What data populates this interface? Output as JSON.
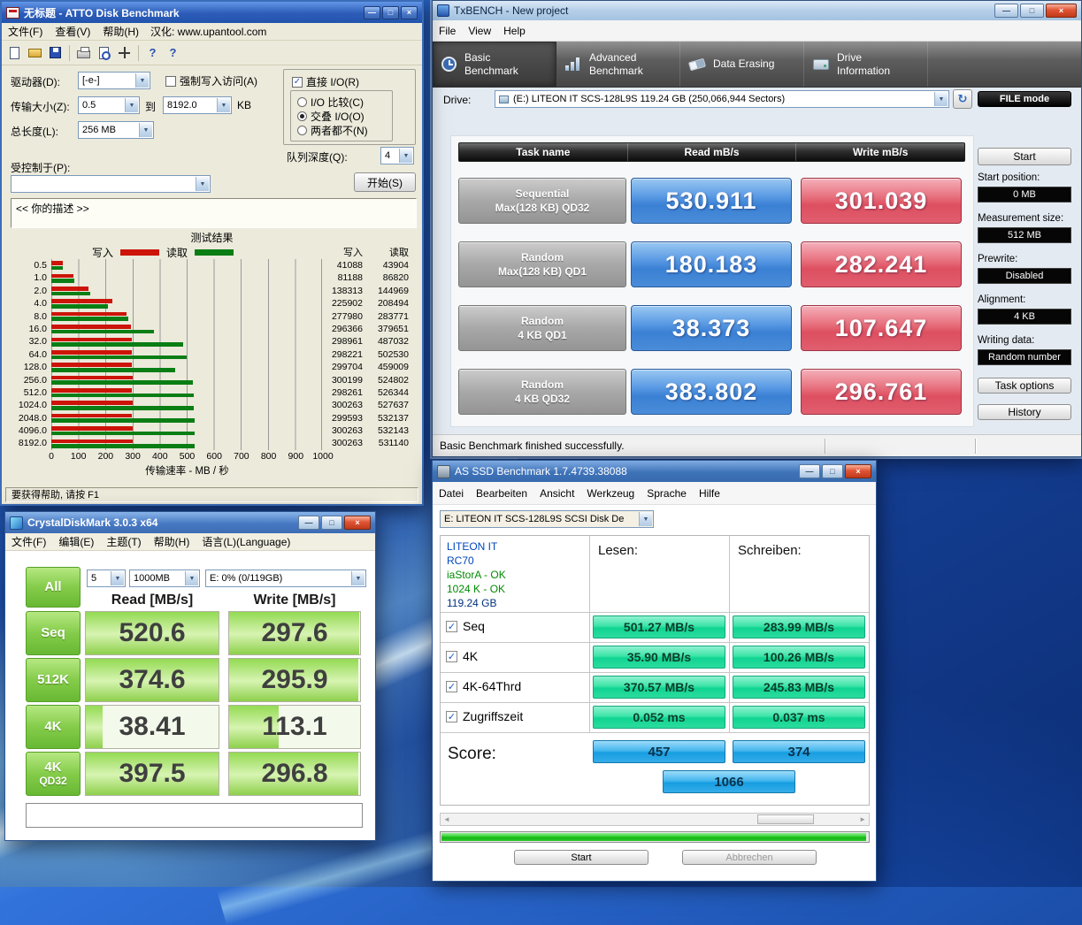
{
  "glyphs": {
    "minimize": "—",
    "maximize": "□",
    "close": "×",
    "combo_arrow": "▼",
    "check": "✓",
    "refresh": "↻",
    "help": "?",
    "scroll_left": "◄",
    "scroll_right": "►"
  },
  "atto": {
    "title": "无标题 - ATTO Disk Benchmark",
    "menu": [
      "文件(F)",
      "查看(V)",
      "帮助(H)"
    ],
    "menu_note": "汉化: www.upantool.com",
    "controls": {
      "drive_label": "驱动器(D):",
      "drive_value": "[-e-]",
      "force_write_label": "强制写入访问(A)",
      "transfer_label": "传输大小(Z):",
      "transfer_from": "0.5",
      "to": "到",
      "transfer_to": "8192.0",
      "kb": "KB",
      "length_label": "总长度(L):",
      "length_value": "256 MB",
      "direct_io_label": "直接 I/O(R)",
      "io_compare_label": "I/O 比较(C)",
      "overlapped_label": "交叠 I/O(O)",
      "neither_label": "两者都不(N)",
      "queue_label": "队列深度(Q):",
      "queue_value": "4",
      "controlled_by_label": "受控制于(P):",
      "start_button": "开始(S)",
      "description_text": "<< 你的描述  >>"
    },
    "status": "要获得帮助, 请按 F1"
  },
  "chart_data": {
    "type": "bar",
    "orientation": "horizontal",
    "title": "测试结果",
    "xlabel": "传输速率 - MB / 秒",
    "xlim": [
      0,
      1000
    ],
    "x_ticks": [
      0,
      100,
      200,
      300,
      400,
      500,
      600,
      700,
      800,
      900,
      1000
    ],
    "categories": [
      "0.5",
      "1.0",
      "2.0",
      "4.0",
      "8.0",
      "16.0",
      "32.0",
      "64.0",
      "128.0",
      "256.0",
      "512.0",
      "1024.0",
      "2048.0",
      "4096.0",
      "8192.0"
    ],
    "series": [
      {
        "name": "写入",
        "color": "#cc1408",
        "values_kb_s": [
          41088,
          81188,
          138313,
          225902,
          277980,
          296366,
          298961,
          298221,
          299704,
          300199,
          298261,
          300263,
          299593,
          300263,
          300263
        ]
      },
      {
        "name": "读取",
        "color": "#0a7e14",
        "values_kb_s": [
          43904,
          86820,
          144969,
          208494,
          283771,
          379651,
          487032,
          502530,
          459009,
          524802,
          526344,
          527637,
          532137,
          532143,
          531140
        ]
      }
    ],
    "legend_position": "top",
    "grid": true
  },
  "txbench": {
    "title": "TxBENCH - New project",
    "menu": [
      "File",
      "View",
      "Help"
    ],
    "tabs": [
      {
        "line1": "Basic",
        "line2": "Benchmark"
      },
      {
        "line1": "Advanced",
        "line2": "Benchmark"
      },
      {
        "line1": "Data Erasing",
        "line2": ""
      },
      {
        "line1": "Drive",
        "line2": "Information"
      }
    ],
    "drive_label": "Drive:",
    "drive_value": "(E:) LITEON IT SCS-128L9S   119.24 GB (250,066,944 Sectors)",
    "file_mode_button": "FILE mode",
    "table": {
      "col_task": "Task name",
      "col_read": "Read mB/s",
      "col_write": "Write mB/s",
      "rows": [
        {
          "task_line1": "Sequential",
          "task_line2": "Max(128 KB) QD32",
          "read": "530.911",
          "write": "301.039"
        },
        {
          "task_line1": "Random",
          "task_line2": "Max(128 KB) QD1",
          "read": "180.183",
          "write": "282.241"
        },
        {
          "task_line1": "Random",
          "task_line2": "4 KB QD1",
          "read": "38.373",
          "write": "107.647"
        },
        {
          "task_line1": "Random",
          "task_line2": "4 KB QD32",
          "read": "383.802",
          "write": "296.761"
        }
      ]
    },
    "side": {
      "start_button": "Start",
      "start_position_label": "Start position:",
      "start_position_value": "0 MB",
      "measurement_label": "Measurement size:",
      "measurement_value": "512 MB",
      "prewrite_label": "Prewrite:",
      "prewrite_value": "Disabled",
      "alignment_label": "Alignment:",
      "alignment_value": "4 KB",
      "writing_label": "Writing data:",
      "writing_value": "Random number",
      "task_options_button": "Task options",
      "history_button": "History"
    },
    "status": "Basic Benchmark finished successfully."
  },
  "cdm": {
    "title": "CrystalDiskMark 3.0.3 x64",
    "menu": [
      "文件(F)",
      "编辑(E)",
      "主题(T)",
      "帮助(H)",
      "语言(L)(Language)"
    ],
    "all_button": "All",
    "test_count": "5",
    "test_size": "1000MB",
    "target_drive": "E: 0% (0/119GB)",
    "read_header": "Read [MB/s]",
    "write_header": "Write [MB/s]",
    "rows": [
      {
        "label_line1": "Seq",
        "label_line2": "",
        "read": "520.6",
        "write": "297.6"
      },
      {
        "label_line1": "512K",
        "label_line2": "",
        "read": "374.6",
        "write": "295.9"
      },
      {
        "label_line1": "4K",
        "label_line2": "",
        "read": "38.41",
        "write": "113.1"
      },
      {
        "label_line1": "4K",
        "label_line2": "QD32",
        "read": "397.5",
        "write": "296.8"
      }
    ],
    "comment": ""
  },
  "asssd": {
    "title": "AS SSD Benchmark 1.7.4739.38088",
    "menu": [
      "Datei",
      "Bearbeiten",
      "Ansicht",
      "Werkzeug",
      "Sprache",
      "Hilfe"
    ],
    "drive_combo": "E: LITEON IT SCS-128L9S SCSI Disk De",
    "info": {
      "model": "LITEON IT",
      "firmware": "RC70",
      "driver": "iaStorA - OK",
      "alignment": "1024 K - OK",
      "capacity": "119.24 GB"
    },
    "read_header": "Lesen:",
    "write_header": "Schreiben:",
    "rows": [
      {
        "label": "Seq",
        "read": "501.27 MB/s",
        "write": "283.99 MB/s"
      },
      {
        "label": "4K",
        "read": "35.90 MB/s",
        "write": "100.26 MB/s"
      },
      {
        "label": "4K-64Thrd",
        "read": "370.57 MB/s",
        "write": "245.83 MB/s"
      },
      {
        "label": "Zugriffszeit",
        "read": "0.052 ms",
        "write": "0.037 ms"
      }
    ],
    "score_label": "Score:",
    "score_read": "457",
    "score_write": "374",
    "score_total": "1066",
    "start_button": "Start",
    "cancel_button": "Abbrechen"
  }
}
